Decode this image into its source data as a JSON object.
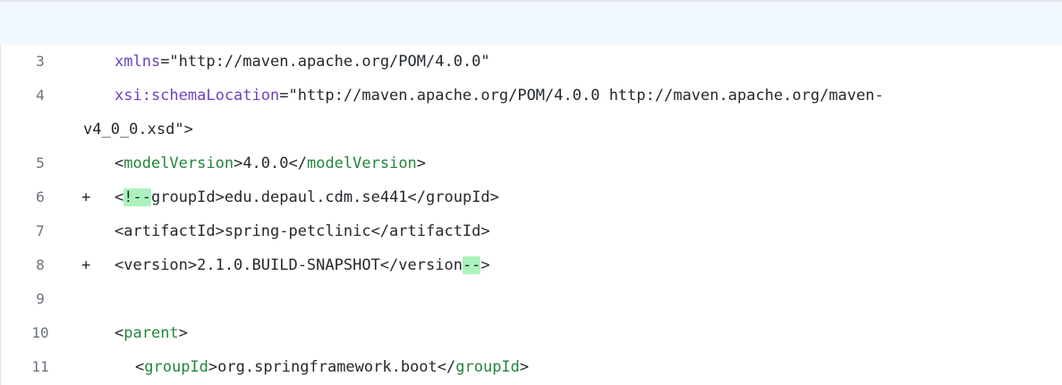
{
  "diff": {
    "lines": [
      {
        "num": "3",
        "marker": "",
        "parts": [
          "xmlns",
          "=\"http://maven.apache.org/POM/4.0.0\""
        ]
      },
      {
        "num": "4",
        "marker": "",
        "parts": [
          "xsi:schemaLocation",
          "=\"http://maven.apache.org/POM/4.0.0 http://maven.apache.org/maven-"
        ],
        "wrap": "v4_0_0.xsd\">"
      },
      {
        "num": "5",
        "marker": "",
        "parts": [
          "<",
          "modelVersion",
          ">4.0.0</",
          "modelVersion",
          ">"
        ]
      },
      {
        "num": "6",
        "marker": "+",
        "parts": [
          "<",
          "!--",
          "groupId>edu.depaul.cdm.se441</groupId>"
        ]
      },
      {
        "num": "7",
        "marker": "",
        "parts": [
          "<artifactId>spring-petclinic</artifactId>"
        ]
      },
      {
        "num": "8",
        "marker": "+",
        "parts": [
          "<version>2.1.0.BUILD-SNAPSHOT</version",
          "--",
          ">"
        ]
      },
      {
        "num": "9",
        "marker": "",
        "parts": []
      },
      {
        "num": "10",
        "marker": "",
        "parts": [
          "<",
          "parent",
          ">"
        ]
      },
      {
        "num": "11",
        "marker": "",
        "parts": [
          "<",
          "groupId",
          ">org.springframework.boot</",
          "groupId",
          ">"
        ]
      }
    ]
  }
}
